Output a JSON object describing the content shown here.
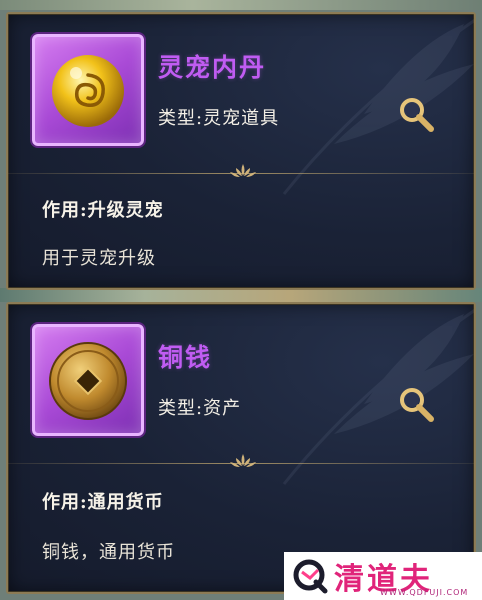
{
  "items": [
    {
      "name": "灵宠内丹",
      "type_text": "类型:灵宠道具",
      "effect": "作用:升级灵宠",
      "description": "用于灵宠升级",
      "icon": "golden-orb-icon"
    },
    {
      "name": "铜钱",
      "type_text": "类型:资产",
      "effect": "作用:通用货币",
      "description": "铜钱，通用货币",
      "icon": "copper-coin-icon"
    }
  ],
  "watermark": {
    "brand": "清道夫",
    "url": "WWW.QDFUJI.COM"
  },
  "colors": {
    "title": "#c05cf2",
    "panel_bg": "#1a2236",
    "border": "#8c7b55"
  }
}
